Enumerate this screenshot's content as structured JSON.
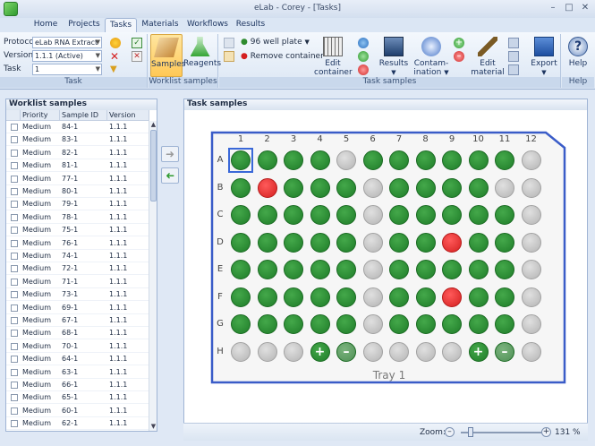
{
  "window": {
    "title": "eLab - Corey - [Tasks]"
  },
  "tabs": [
    "Home",
    "Projects",
    "Tasks",
    "Materials",
    "Workflows",
    "Results"
  ],
  "active_tab": "Tasks",
  "ribbon": {
    "task_group": {
      "label": "Task",
      "protocol_label": "Protocol",
      "protocol_value": "eLab RNA Extract",
      "version_label": "Version",
      "version_value": "1.1.1 (Active)",
      "task_label": "Task",
      "task_value": "1"
    },
    "worklist_group": {
      "label": "Worklist samples",
      "samples": "Samples",
      "reagents": "Reagents"
    },
    "task_samples_group": {
      "label": "Task samples",
      "plate": "96 well plate",
      "remove": "Remove container",
      "edit_container": "Edit container",
      "results": "Results",
      "contamination": "Contam-ination",
      "edit_material": "Edit material",
      "export": "Export"
    },
    "help_group": {
      "label": "Help",
      "help": "Help"
    }
  },
  "worklist": {
    "title": "Worklist samples",
    "columns": [
      "Priority",
      "Sample ID",
      "Version"
    ],
    "rows": [
      [
        "Medium",
        "84-1",
        "1.1.1"
      ],
      [
        "Medium",
        "83-1",
        "1.1.1"
      ],
      [
        "Medium",
        "82-1",
        "1.1.1"
      ],
      [
        "Medium",
        "81-1",
        "1.1.1"
      ],
      [
        "Medium",
        "77-1",
        "1.1.1"
      ],
      [
        "Medium",
        "80-1",
        "1.1.1"
      ],
      [
        "Medium",
        "79-1",
        "1.1.1"
      ],
      [
        "Medium",
        "78-1",
        "1.1.1"
      ],
      [
        "Medium",
        "75-1",
        "1.1.1"
      ],
      [
        "Medium",
        "76-1",
        "1.1.1"
      ],
      [
        "Medium",
        "74-1",
        "1.1.1"
      ],
      [
        "Medium",
        "72-1",
        "1.1.1"
      ],
      [
        "Medium",
        "71-1",
        "1.1.1"
      ],
      [
        "Medium",
        "73-1",
        "1.1.1"
      ],
      [
        "Medium",
        "69-1",
        "1.1.1"
      ],
      [
        "Medium",
        "67-1",
        "1.1.1"
      ],
      [
        "Medium",
        "68-1",
        "1.1.1"
      ],
      [
        "Medium",
        "70-1",
        "1.1.1"
      ],
      [
        "Medium",
        "64-1",
        "1.1.1"
      ],
      [
        "Medium",
        "63-1",
        "1.1.1"
      ],
      [
        "Medium",
        "66-1",
        "1.1.1"
      ],
      [
        "Medium",
        "65-1",
        "1.1.1"
      ],
      [
        "Medium",
        "60-1",
        "1.1.1"
      ],
      [
        "Medium",
        "62-1",
        "1.1.1"
      ]
    ]
  },
  "task_samples": {
    "title": "Task samples",
    "tray_label": "Tray 1",
    "column_labels": [
      "1",
      "2",
      "3",
      "4",
      "5",
      "6",
      "7",
      "8",
      "9",
      "10",
      "11",
      "12"
    ],
    "row_labels": [
      "A",
      "B",
      "C",
      "D",
      "E",
      "F",
      "G",
      "H"
    ],
    "wells": [
      "ggggxggggggx",
      "grgggxggggxx",
      "gggggxgggggx",
      "gggggxggrggx",
      "gggggxgggggx",
      "gggggxggrggx",
      "gggggxgggggx",
      "xxx+-xxxx+-x"
    ],
    "colors": {
      "filled": "#1f7d29",
      "empty": "#b4b4b4",
      "error": "#d42020",
      "selected": "#3a68d8"
    }
  },
  "status": {
    "zoom_label": "Zoom:",
    "zoom_value": "131 %"
  }
}
